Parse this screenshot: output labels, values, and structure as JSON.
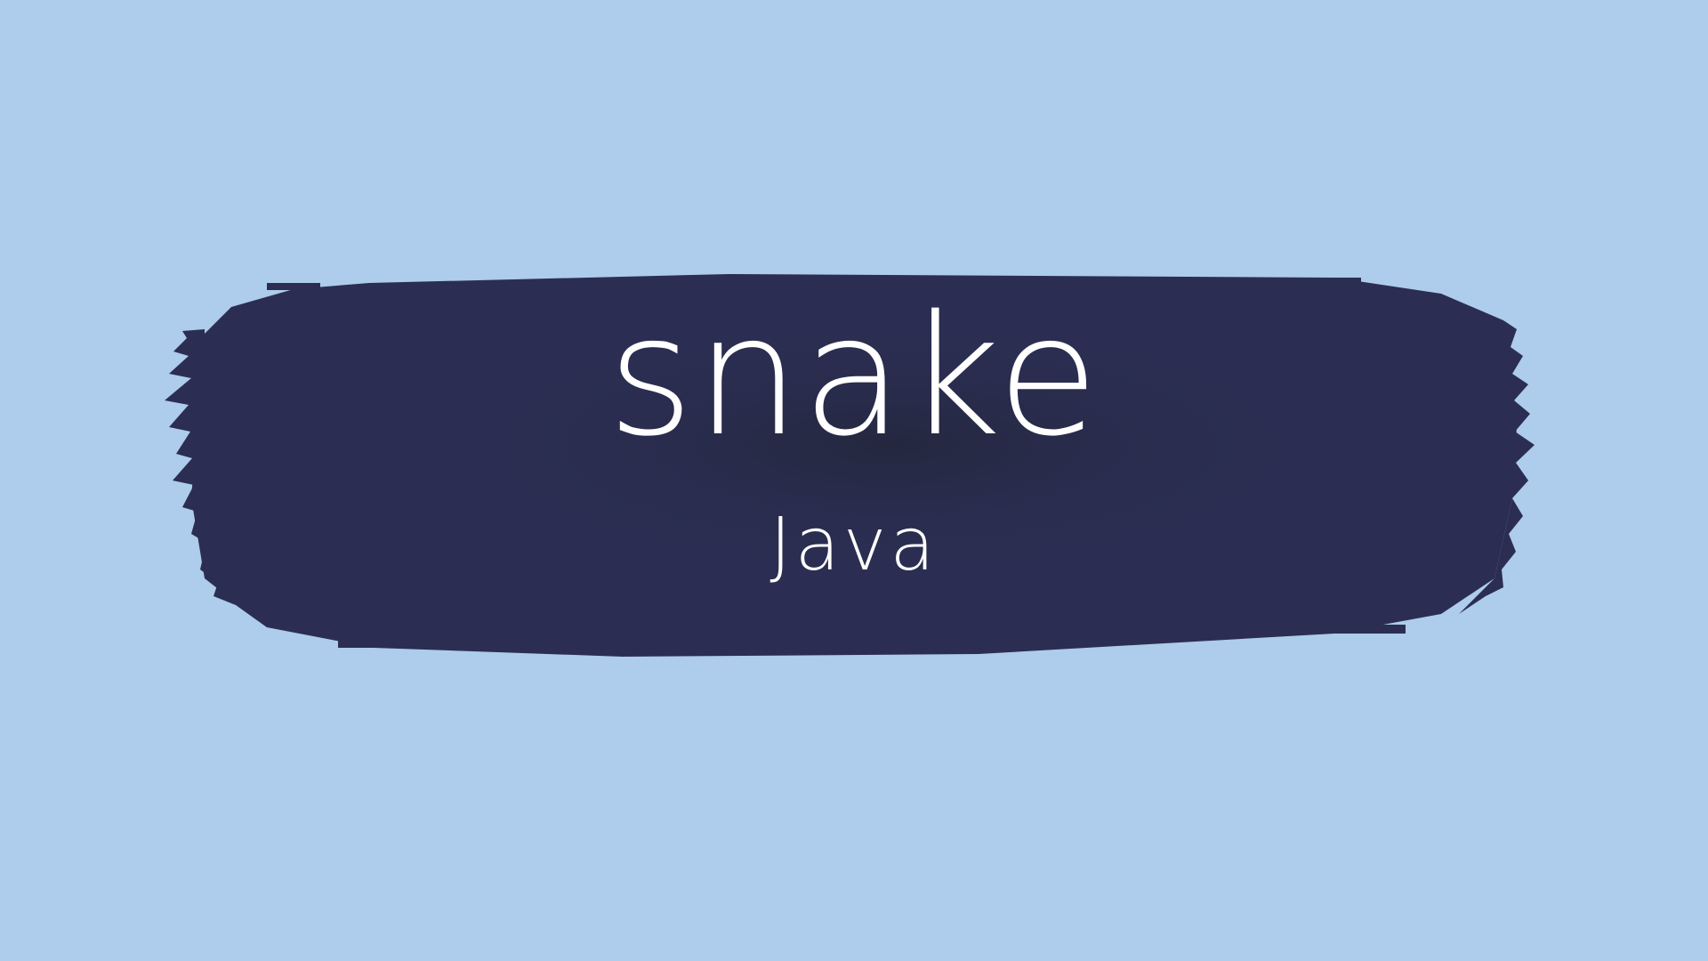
{
  "title": "snake",
  "subtitle": "Java",
  "colors": {
    "background": "#aecceb",
    "brush": "#2b2e52",
    "brush_dark": "#24283f",
    "text": "#ffffff"
  }
}
